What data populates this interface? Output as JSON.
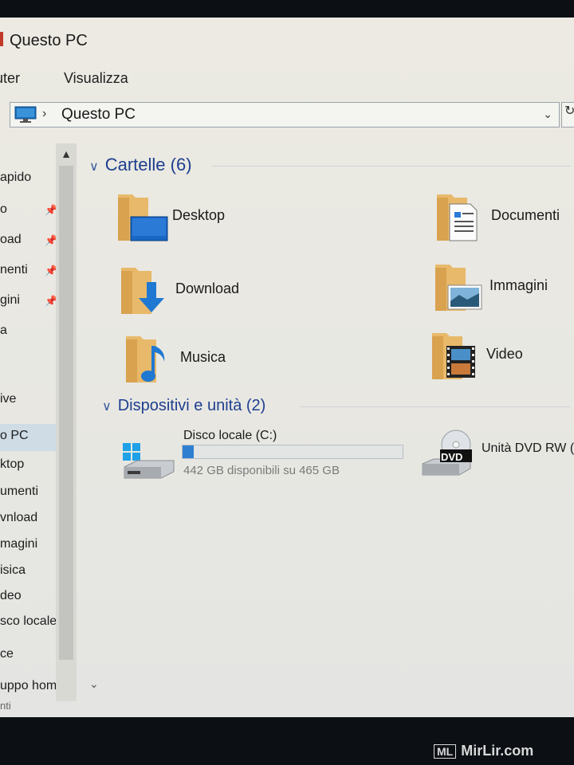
{
  "window": {
    "title": "Questo PC"
  },
  "ribbon": {
    "tabs": [
      "uter",
      "Visualizza"
    ]
  },
  "address": {
    "path": "Questo PC",
    "chevron": "›",
    "dropdown": "⌄",
    "refresh": "↻"
  },
  "nav": {
    "items": [
      {
        "label": "apido",
        "pinned": false
      },
      {
        "label": "o",
        "pinned": true
      },
      {
        "label": "oad",
        "pinned": true
      },
      {
        "label": "nenti",
        "pinned": true
      },
      {
        "label": "gini",
        "pinned": true
      },
      {
        "label": "a",
        "pinned": false
      },
      {
        "label": "ive",
        "pinned": false
      },
      {
        "label": "o PC",
        "pinned": false,
        "selected": true
      },
      {
        "label": "ktop",
        "pinned": false
      },
      {
        "label": "umenti",
        "pinned": false
      },
      {
        "label": "vnload",
        "pinned": false
      },
      {
        "label": "magini",
        "pinned": false
      },
      {
        "label": "isica",
        "pinned": false
      },
      {
        "label": "deo",
        "pinned": false
      },
      {
        "label": "sco locale (C:)",
        "pinned": false
      },
      {
        "label": "ce",
        "pinned": false
      },
      {
        "label": "uppo home",
        "pinned": false
      },
      {
        "label": "nti",
        "pinned": false
      }
    ]
  },
  "folders": {
    "header": "Cartelle (6)",
    "items": [
      {
        "label": "Desktop",
        "icon": "desktop-folder-icon"
      },
      {
        "label": "Documenti",
        "icon": "documents-folder-icon"
      },
      {
        "label": "Download",
        "icon": "download-folder-icon"
      },
      {
        "label": "Immagini",
        "icon": "pictures-folder-icon"
      },
      {
        "label": "Musica",
        "icon": "music-folder-icon"
      },
      {
        "label": "Video",
        "icon": "video-folder-icon"
      }
    ]
  },
  "devices": {
    "header": "Dispositivi e unità (2)",
    "drive_c": {
      "label": "Disco locale (C:)",
      "free_text": "442 GB disponibili su 465 GB",
      "used_fraction": 0.049,
      "accent": "#2f7fd0"
    },
    "dvd": {
      "label": "Unità DVD RW (",
      "badge": "DVD"
    }
  },
  "watermark": {
    "ml": "ML",
    "text": "MirLir.com"
  }
}
